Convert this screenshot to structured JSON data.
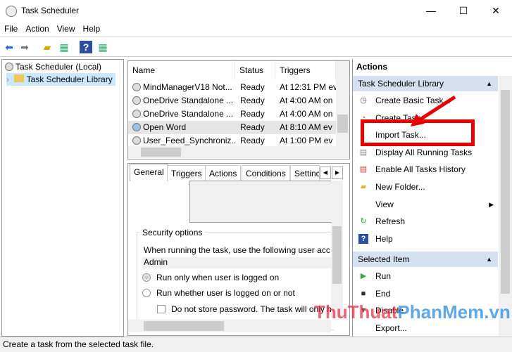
{
  "window": {
    "title": "Task Scheduler",
    "min": "—",
    "max": "☐",
    "close": "✕"
  },
  "menu": [
    "File",
    "Action",
    "View",
    "Help"
  ],
  "tree": {
    "root": "Task Scheduler (Local)",
    "library": "Task Scheduler Library"
  },
  "task_list": {
    "headers": [
      "Name",
      "Status",
      "Triggers"
    ],
    "rows": [
      {
        "name": "MindManagerV18 Not...",
        "status": "Ready",
        "trigger": "At 12:31 PM ev"
      },
      {
        "name": "OneDrive Standalone ...",
        "status": "Ready",
        "trigger": "At 4:00 AM on"
      },
      {
        "name": "OneDrive Standalone ...",
        "status": "Ready",
        "trigger": "At 4:00 AM on"
      },
      {
        "name": "Open Word",
        "status": "Ready",
        "trigger": "At 8:10 AM ev"
      },
      {
        "name": "User_Feed_Synchroniz...",
        "status": "Ready",
        "trigger": "At 1:00 PM ev"
      }
    ]
  },
  "detail": {
    "tabs": [
      "General",
      "Triggers",
      "Actions",
      "Conditions",
      "Settinc"
    ],
    "security_title": "Security options",
    "user_prompt": "When running the task, use the following user acc",
    "user": "Admin",
    "opt1": "Run only when user is logged on",
    "opt2": "Run whether user is logged on or not",
    "opt3": "Do not store password.  The task will only h"
  },
  "actions": {
    "title": "Actions",
    "section1": "Task Scheduler Library",
    "items1": [
      "Create Basic Task...",
      "Create Task...",
      "Import Task...",
      "Display All Running Tasks",
      "Enable All Tasks History",
      "New Folder...",
      "View",
      "Refresh",
      "Help"
    ],
    "section2": "Selected Item",
    "items2": [
      "Run",
      "End",
      "Disable",
      "Export..."
    ]
  },
  "status": "Create a task from the selected task file.",
  "watermark": "ThuThuatPhanMem.vn",
  "colors": {
    "highlight": "#e60000",
    "section": "#d5e1f0"
  }
}
